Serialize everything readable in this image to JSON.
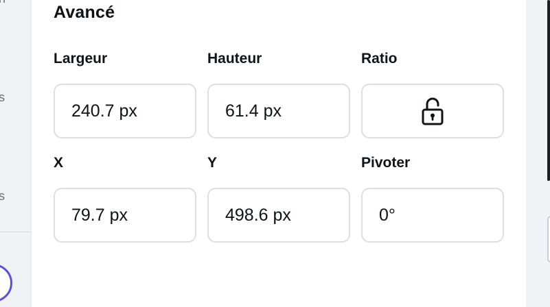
{
  "left_strip": {
    "fragments": [
      "n",
      "s",
      "s"
    ]
  },
  "panel": {
    "section_title": "Avancé",
    "fields": {
      "width": {
        "label": "Largeur",
        "value": "240.7 px"
      },
      "height": {
        "label": "Hauteur",
        "value": "61.4 px"
      },
      "ratio": {
        "label": "Ratio",
        "icon": "unlock-icon"
      },
      "x": {
        "label": "X",
        "value": "79.7 px"
      },
      "y": {
        "label": "Y",
        "value": "498.6 px"
      },
      "rotate": {
        "label": "Pivoter",
        "value": "0°"
      }
    }
  },
  "colors": {
    "panel_bg": "#ffffff",
    "app_bg": "#f1f2f6",
    "field_border": "#dcdee3",
    "text": "#0e1318",
    "accent_ring": "#5a4fe0"
  }
}
